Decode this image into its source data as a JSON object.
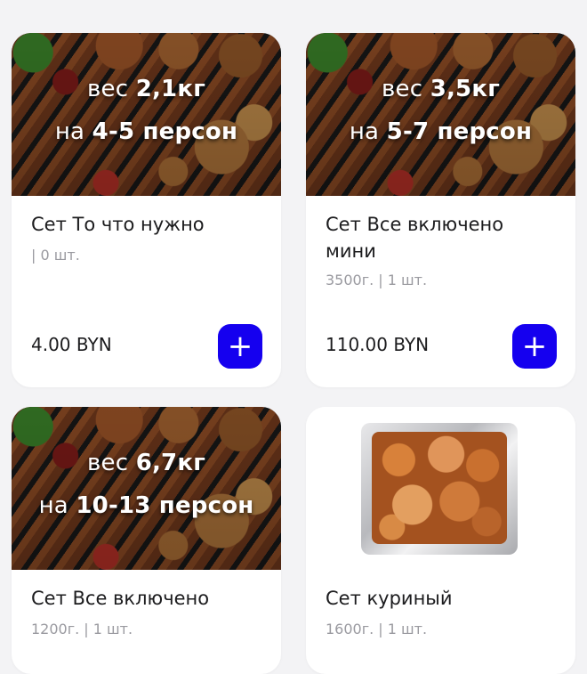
{
  "theme": {
    "accent": "#1500ef",
    "background": "#f3f3f5",
    "card": "#ffffff"
  },
  "products": [
    {
      "title": "Сет То что нужно",
      "meta": "| 0 шт.",
      "price": "4.00 BYN",
      "add_label": "+",
      "promo": {
        "weight_prefix": "вес",
        "weight": "2,1кг",
        "persons_prefix": "на",
        "persons": "4-5 персон"
      }
    },
    {
      "title": "Сет Все включено мини",
      "meta": "3500г. | 1 шт.",
      "price": "110.00 BYN",
      "add_label": "+",
      "promo": {
        "weight_prefix": "вес",
        "weight": "3,5кг",
        "persons_prefix": "на",
        "persons": "5-7 персон"
      }
    },
    {
      "title": "Сет Все включено",
      "meta": "1200г. | 1 шт.",
      "promo": {
        "weight_prefix": "вес",
        "weight": "6,7кг",
        "persons_prefix": "на",
        "persons": "10-13 персон"
      }
    },
    {
      "title": "Сет куриный",
      "meta": "1600г. | 1 шт."
    }
  ]
}
